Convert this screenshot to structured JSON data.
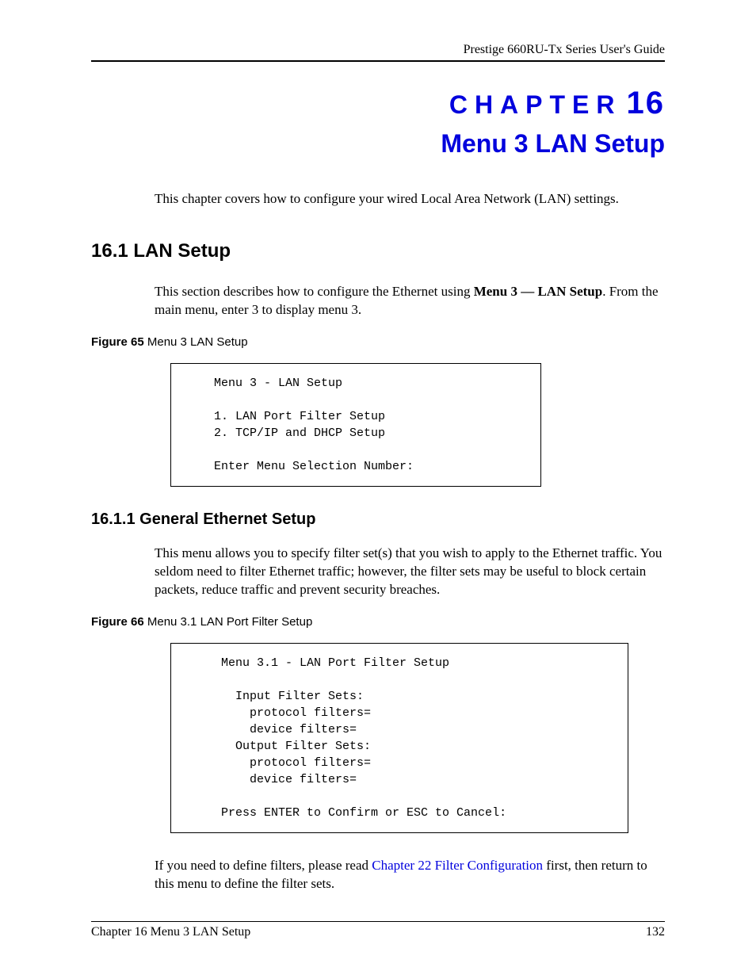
{
  "header": {
    "guide_title": "Prestige 660RU-Tx Series User's Guide"
  },
  "chapter": {
    "word": "CHAPTER",
    "number": "16",
    "title": "Menu 3 LAN Setup"
  },
  "intro": "This chapter covers how to configure your wired Local Area Network (LAN) settings.",
  "section_16_1": {
    "heading": "16.1  LAN Setup",
    "para_pre": "This section describes how to configure the Ethernet using ",
    "para_bold": "Menu 3 — LAN Setup",
    "para_post": ". From the main menu, enter 3 to display menu 3."
  },
  "figure65": {
    "label_bold": "Figure 65",
    "label_rest": "   Menu 3 LAN Setup",
    "content": "    Menu 3 - LAN Setup\n\n    1. LAN Port Filter Setup\n    2. TCP/IP and DHCP Setup\n\n    Enter Menu Selection Number:"
  },
  "section_16_1_1": {
    "heading": "16.1.1  General Ethernet Setup",
    "para": "This menu allows you to specify filter set(s) that you wish to apply to the Ethernet traffic.  You seldom need to filter Ethernet traffic; however, the filter sets may be useful to block certain packets, reduce traffic and prevent security breaches."
  },
  "figure66": {
    "label_bold": "Figure 66",
    "label_rest": "   Menu 3.1 LAN Port Filter Setup",
    "content": "     Menu 3.1 - LAN Port Filter Setup\n\n       Input Filter Sets:\n         protocol filters=\n         device filters=\n       Output Filter Sets:\n         protocol filters=\n         device filters=\n\n     Press ENTER to Confirm or ESC to Cancel:"
  },
  "closing": {
    "pre": "If you need to define filters, please read ",
    "link": "Chapter 22 Filter Configuration",
    "post": " first, then return to this menu to define the filter sets."
  },
  "footer": {
    "left": "Chapter 16 Menu 3 LAN Setup",
    "right": "132"
  }
}
